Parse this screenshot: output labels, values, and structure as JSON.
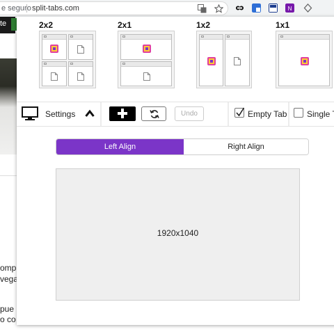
{
  "browser": {
    "secure_label": "e seguro",
    "url": "split-tabs.com"
  },
  "page_behind": {
    "nav_fragment": "te",
    "text_lines": [
      "ompl",
      "vega",
      "pue",
      "o co"
    ]
  },
  "layouts": [
    {
      "label": "2x2",
      "icon": "layout-2x2-icon"
    },
    {
      "label": "2x1",
      "icon": "layout-2x1-icon"
    },
    {
      "label": "1x2",
      "icon": "layout-1x2-icon"
    },
    {
      "label": "1x1",
      "icon": "layout-1x1-icon"
    }
  ],
  "toolbar": {
    "settings_label": "Settings",
    "undo_label": "Undo",
    "empty_tab_label": "Empty Tab",
    "empty_tab_checked": true,
    "single_tab_label": "Single Ta",
    "single_tab_checked": false
  },
  "align": {
    "left_label": "Left Align",
    "right_label": "Right Align",
    "selected": "left",
    "accent": "#7b35c8"
  },
  "screen": {
    "resolution": "1920x1040"
  }
}
